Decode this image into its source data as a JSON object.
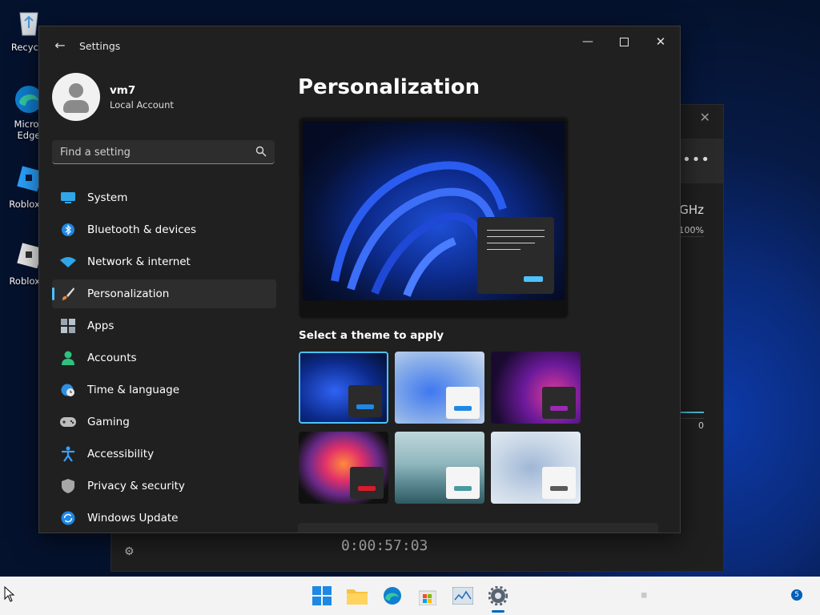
{
  "desktop": {
    "icons": [
      {
        "label": "Recycle",
        "icon": "recycle-bin-icon"
      },
      {
        "label": "Micros Edge",
        "icon": "edge-icon"
      },
      {
        "label": "Roblox S",
        "icon": "roblox-studio-icon"
      },
      {
        "label": "Roblox P",
        "icon": "roblox-player-icon"
      }
    ]
  },
  "background_window": {
    "ghz": "GHz",
    "pct_max": "100%",
    "pct_min": "0",
    "timer": "0:00:57:03"
  },
  "settings": {
    "title": "Settings",
    "profile": {
      "name": "vm7",
      "account_type": "Local Account"
    },
    "search": {
      "placeholder": "Find a setting"
    },
    "nav": [
      {
        "label": "System",
        "icon": "system-icon",
        "active": false
      },
      {
        "label": "Bluetooth & devices",
        "icon": "bluetooth-icon",
        "active": false
      },
      {
        "label": "Network & internet",
        "icon": "wifi-icon",
        "active": false
      },
      {
        "label": "Personalization",
        "icon": "brush-icon",
        "active": true
      },
      {
        "label": "Apps",
        "icon": "apps-icon",
        "active": false
      },
      {
        "label": "Accounts",
        "icon": "accounts-icon",
        "active": false
      },
      {
        "label": "Time & language",
        "icon": "globe-clock-icon",
        "active": false
      },
      {
        "label": "Gaming",
        "icon": "gamepad-icon",
        "active": false
      },
      {
        "label": "Accessibility",
        "icon": "accessibility-icon",
        "active": false
      },
      {
        "label": "Privacy & security",
        "icon": "shield-icon",
        "active": false
      },
      {
        "label": "Windows Update",
        "icon": "update-icon",
        "active": false
      }
    ],
    "content": {
      "page_title": "Personalization",
      "theme_heading": "Select a theme to apply",
      "themes": [
        {
          "name": "windows-dark",
          "selected": true
        },
        {
          "name": "windows-light",
          "selected": false
        },
        {
          "name": "glow",
          "selected": false
        },
        {
          "name": "captured-motion",
          "selected": false
        },
        {
          "name": "sunrise",
          "selected": false
        },
        {
          "name": "flow",
          "selected": false
        }
      ]
    }
  },
  "colors": {
    "accent": "#4cc2ff",
    "window_bg": "#202020",
    "taskbar_bg": "#f3f3f3"
  },
  "taskbar": {
    "items": [
      "start-icon",
      "file-explorer-icon",
      "edge-icon",
      "store-icon",
      "task-manager-icon",
      "settings-icon"
    ],
    "notification_count": "5"
  }
}
